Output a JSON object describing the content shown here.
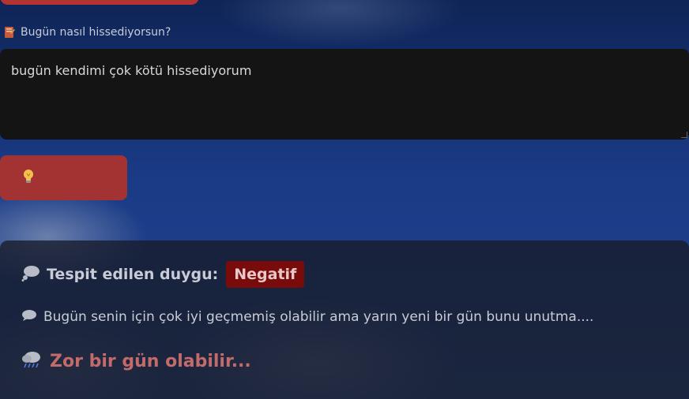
{
  "form": {
    "label": "Bugün nasıl hissediyorsun?",
    "label_icon": "diary-icon",
    "input_value": "bugün kendimi çok kötü hissediyorum",
    "submit_icon": "lightbulb-icon",
    "submit_label": ""
  },
  "result": {
    "emotion_icon": "thought-bubble-icon",
    "emotion_title": "Tespit edilen duygu:",
    "emotion_value": "Negatif",
    "message_icon": "speech-bubble-icon",
    "message": "Bugün senin için çok iyi geçmemiş olabilir ama yarın yeni bir gün bunu unutma....",
    "verdict_icon": "rain-cloud-icon",
    "verdict": "Zor bir gün olabilir..."
  },
  "colors": {
    "button": "#a33232",
    "badge": "#7a0b0b",
    "verdict_text": "#c36a6a",
    "textarea_bg": "#141414"
  }
}
